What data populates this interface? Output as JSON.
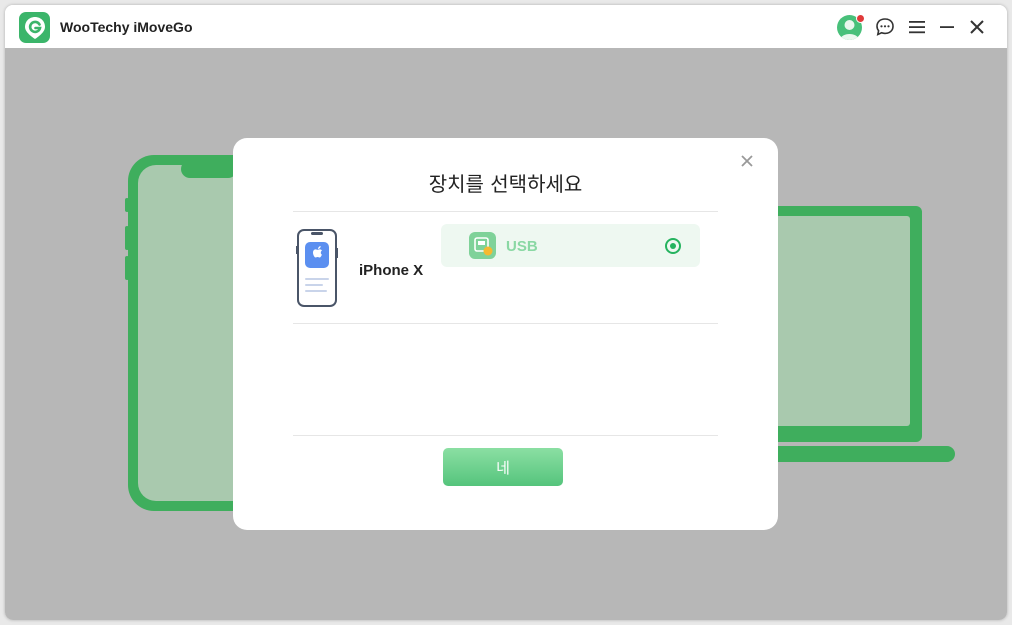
{
  "app": {
    "title": "WooTechy iMoveGo",
    "logo_icon": "g-location-pin-icon",
    "accent_color": "#3bb56a"
  },
  "titlebar": {
    "icons": [
      "avatar-icon",
      "chat-bubble-icon",
      "menu-icon",
      "minimize-icon",
      "close-icon"
    ],
    "notification_color": "#e03a3a"
  },
  "dialog": {
    "title": "장치를 선택하세요",
    "close_icon": "close-icon",
    "device": {
      "name": "iPhone X",
      "icon": "iphone-icon"
    },
    "connection": {
      "label": "USB",
      "icon": "usb-device-icon",
      "selected": true,
      "highlight_color": "#eef8f1",
      "label_color": "#8ad8a4"
    },
    "confirm_label": "네"
  },
  "background": {
    "overlay_color": "#b7b7b7",
    "illustration_color": "#3fae5d",
    "illustration": "phone-and-laptop-illustration"
  }
}
